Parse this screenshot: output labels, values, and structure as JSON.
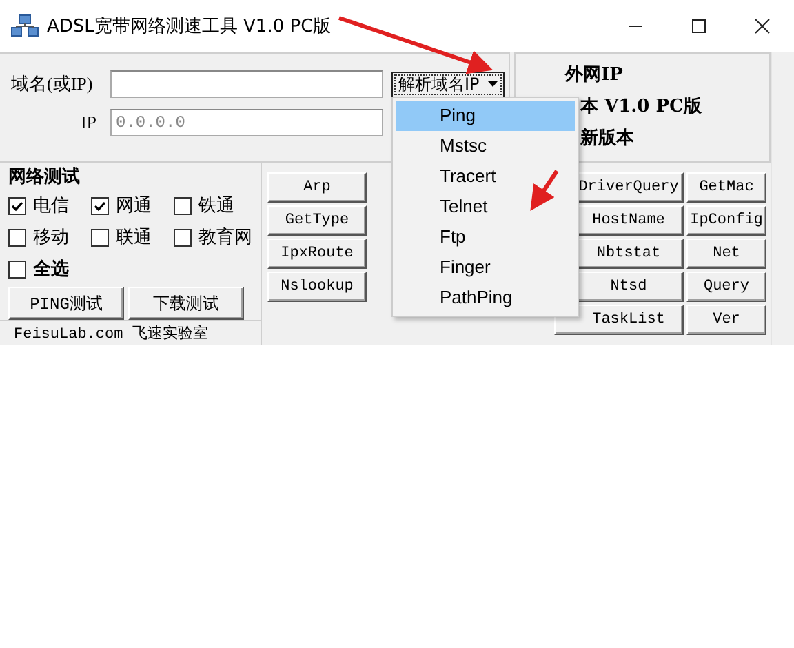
{
  "window": {
    "title": "ADSL宽带网络测速工具 V1.0 PC版"
  },
  "lookup": {
    "domain_label": "域名(或IP)",
    "ip_label": "IP",
    "ip_value": "0.0.0.0",
    "resolve_button": "解析域名IP"
  },
  "info": {
    "lines": [
      "外网IP",
      "本 V1.0 PC版",
      "新版本"
    ]
  },
  "network_test": {
    "title": "网络测试",
    "options": [
      {
        "label": "电信",
        "checked": true
      },
      {
        "label": "网通",
        "checked": true
      },
      {
        "label": "铁通",
        "checked": false
      },
      {
        "label": "移动",
        "checked": false
      },
      {
        "label": "联通",
        "checked": false
      },
      {
        "label": "教育网",
        "checked": false
      }
    ],
    "select_all": {
      "label": "全选",
      "checked": false
    },
    "buttons": [
      "PING测试",
      "下载测试"
    ]
  },
  "tools": {
    "column_1": [
      "Arp",
      "GetType",
      "IpxRoute",
      "Nslookup"
    ],
    "right_rows": [
      [
        "DriverQuery",
        "GetMac"
      ],
      [
        "HostName",
        "IpConfig"
      ],
      [
        "Nbtstat",
        "Net"
      ],
      [
        "Ntsd",
        "Query"
      ],
      [
        "TaskList",
        "Ver"
      ]
    ]
  },
  "status_bar": {
    "text": "FeisuLab.com 飞速实验室"
  },
  "menu": {
    "items": [
      {
        "label": "Ping",
        "selected": true
      },
      {
        "label": "Mstsc",
        "selected": false
      },
      {
        "label": "Tracert",
        "selected": false
      },
      {
        "label": "Telnet",
        "selected": false
      },
      {
        "label": "Ftp",
        "selected": false
      },
      {
        "label": "Finger",
        "selected": false
      },
      {
        "label": "PathPing",
        "selected": false
      }
    ]
  }
}
